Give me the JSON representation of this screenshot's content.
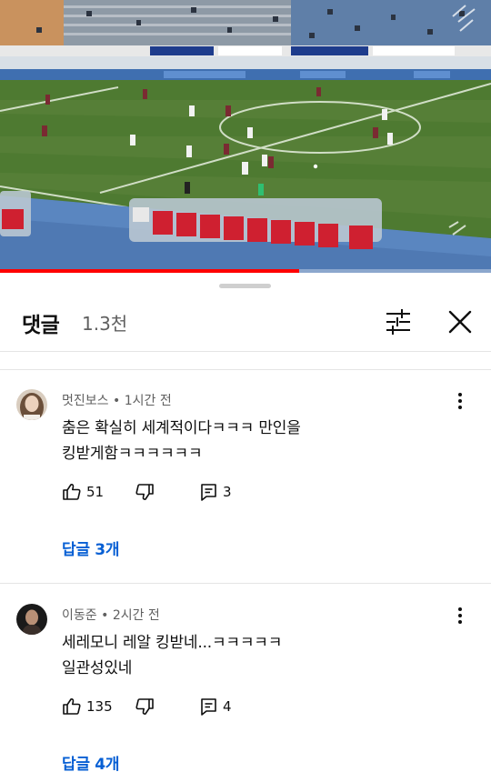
{
  "video": {
    "progress_fraction": 0.61,
    "colors": {
      "pitch": "#4e7a31",
      "track": "#5a86c0",
      "progress": "#ff0000"
    }
  },
  "sheet": {
    "title": "댓글",
    "count": "1.3천",
    "icons": {
      "filter": "sliders-icon",
      "close": "close-icon"
    }
  },
  "comments": [
    {
      "author": "멋진보스",
      "time": "1시간 전",
      "text_lines": [
        "춤은 확실히 세계적이다ㅋㅋㅋ 만인을",
        "킹받게함ㅋㅋㅋㅋㅋㅋ"
      ],
      "likes": "51",
      "reply_count": "3",
      "replies_label": "답글 3개"
    },
    {
      "author": "이동준",
      "time": "2시간 전",
      "text_lines": [
        "세레모니 레알 킹받네...ㅋㅋㅋㅋㅋ",
        "일관성있네"
      ],
      "likes": "135",
      "reply_count": "4",
      "replies_label": "답글 4개"
    }
  ],
  "meta_separator": "•",
  "link_color": "#065fd4"
}
